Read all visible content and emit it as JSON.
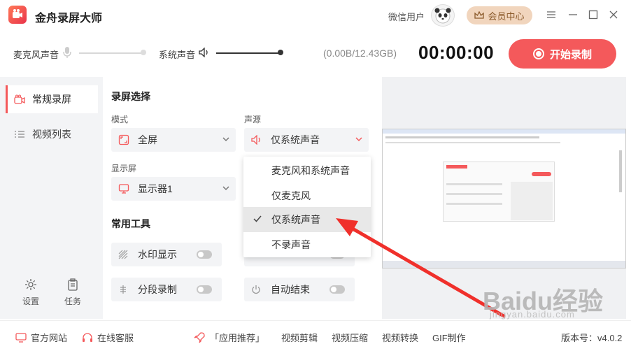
{
  "app": {
    "title": "金舟录屏大师"
  },
  "header": {
    "user_name": "微信用户",
    "vip_label": "会员中心"
  },
  "audio": {
    "mic_label": "麦克风声音",
    "system_label": "系统声音",
    "storage": "(0.00B/12.43GB)",
    "timer": "00:00:00",
    "record_label": "开始录制"
  },
  "sidebar": {
    "items": [
      {
        "label": "常规录屏",
        "active": true
      },
      {
        "label": "视频列表",
        "active": false
      }
    ],
    "settings_label": "设置",
    "tasks_label": "任务"
  },
  "main": {
    "section_capture": "录屏选择",
    "mode_label": "模式",
    "mode_value": "全屏",
    "audio_source_label": "声源",
    "audio_source_value": "仅系统声音",
    "display_label": "显示屏",
    "display_value": "显示器1",
    "section_tools": "常用工具",
    "tools": [
      {
        "label": "水印显示"
      },
      {
        "label": "分段录制"
      },
      {
        "label": "自动结束"
      }
    ]
  },
  "dropdown": {
    "options": [
      {
        "label": "麦克风和系统声音"
      },
      {
        "label": "仅麦克风"
      },
      {
        "label": "仅系统声音"
      },
      {
        "label": "不录声音"
      }
    ]
  },
  "footer": {
    "website": "官方网站",
    "support": "在线客服",
    "app_recommend": "「应用推荐」",
    "links": [
      "视频剪辑",
      "视频压缩",
      "视频转换",
      "GIF制作"
    ],
    "version": "版本号：v4.0.2"
  },
  "watermark": {
    "brand": "Baidu经验",
    "sub": "jingyan.baidu.com"
  },
  "colors": {
    "accent": "#f4595b",
    "vip": "#f1d5bd",
    "panel": "#f3f4f6"
  }
}
